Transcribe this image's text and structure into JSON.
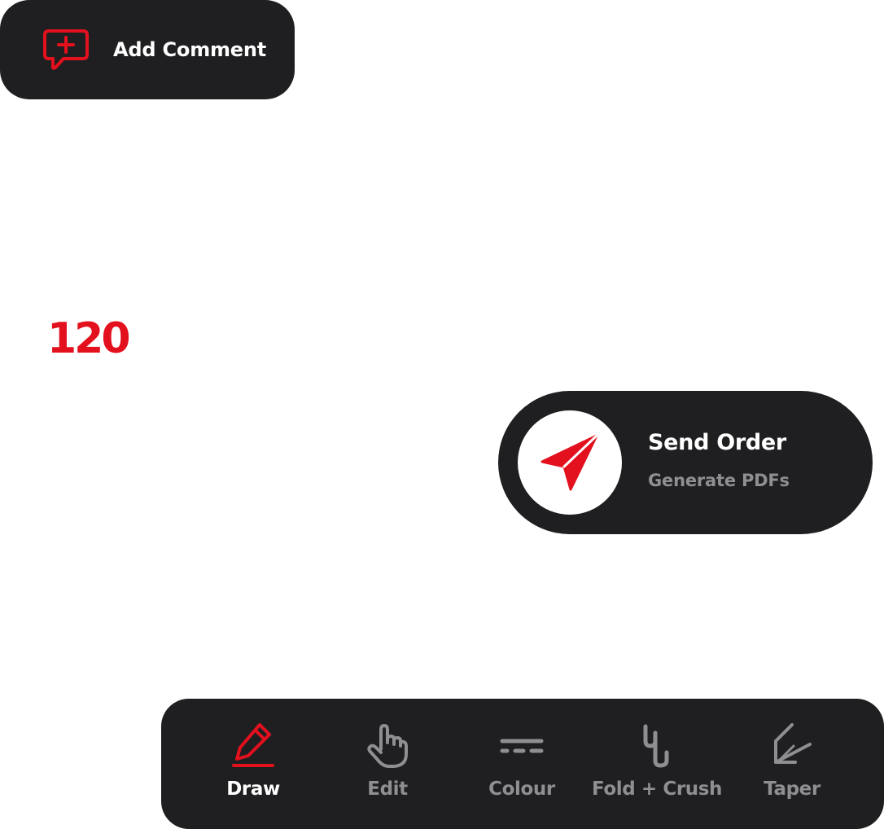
{
  "colors": {
    "accent": "#e3101d",
    "panel": "#1f1f21",
    "muted": "#8e8e93",
    "text": "#ffffff"
  },
  "add_comment": {
    "label": "Add Comment",
    "icon": "comment-plus-icon"
  },
  "counter": {
    "value": "120"
  },
  "send_order": {
    "title": "Send Order",
    "subtitle": "Generate PDFs",
    "icon": "paper-plane-icon"
  },
  "toolbar": {
    "active": "Draw",
    "items": [
      {
        "label": "Draw",
        "icon": "pencil-icon"
      },
      {
        "label": "Edit",
        "icon": "hand-pointer-icon"
      },
      {
        "label": "Colour",
        "icon": "dashed-lines-icon"
      },
      {
        "label": "Fold + Crush",
        "icon": "fold-crush-icon"
      },
      {
        "label": "Taper",
        "icon": "taper-icon"
      }
    ]
  }
}
